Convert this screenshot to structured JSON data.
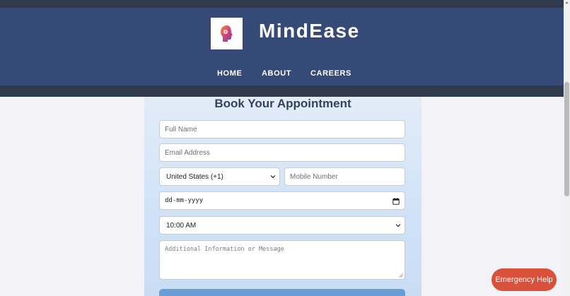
{
  "header": {
    "brand": "MindEase",
    "logo_icon": "head-silhouette-icon",
    "nav": [
      {
        "label": "HOME"
      },
      {
        "label": "ABOUT"
      },
      {
        "label": "CAREERS"
      }
    ]
  },
  "form": {
    "title": "Book Your Appointment",
    "full_name_placeholder": "Full Name",
    "email_placeholder": "Email Address",
    "country_selected": "United States (+1)",
    "mobile_placeholder": "Mobile Number",
    "date_placeholder": "dd-mm-yyyy",
    "time_selected": "10:00 AM",
    "message_placeholder": "Additional Information or Message"
  },
  "emergency": {
    "label": "Emergency Help"
  },
  "colors": {
    "header_bg": "#364a78",
    "header_strip": "#2f3a4c",
    "card_gradient_top": "#e2ecf9",
    "submit_button": "#6a9dd6",
    "emergency_button": "#d9513b"
  }
}
